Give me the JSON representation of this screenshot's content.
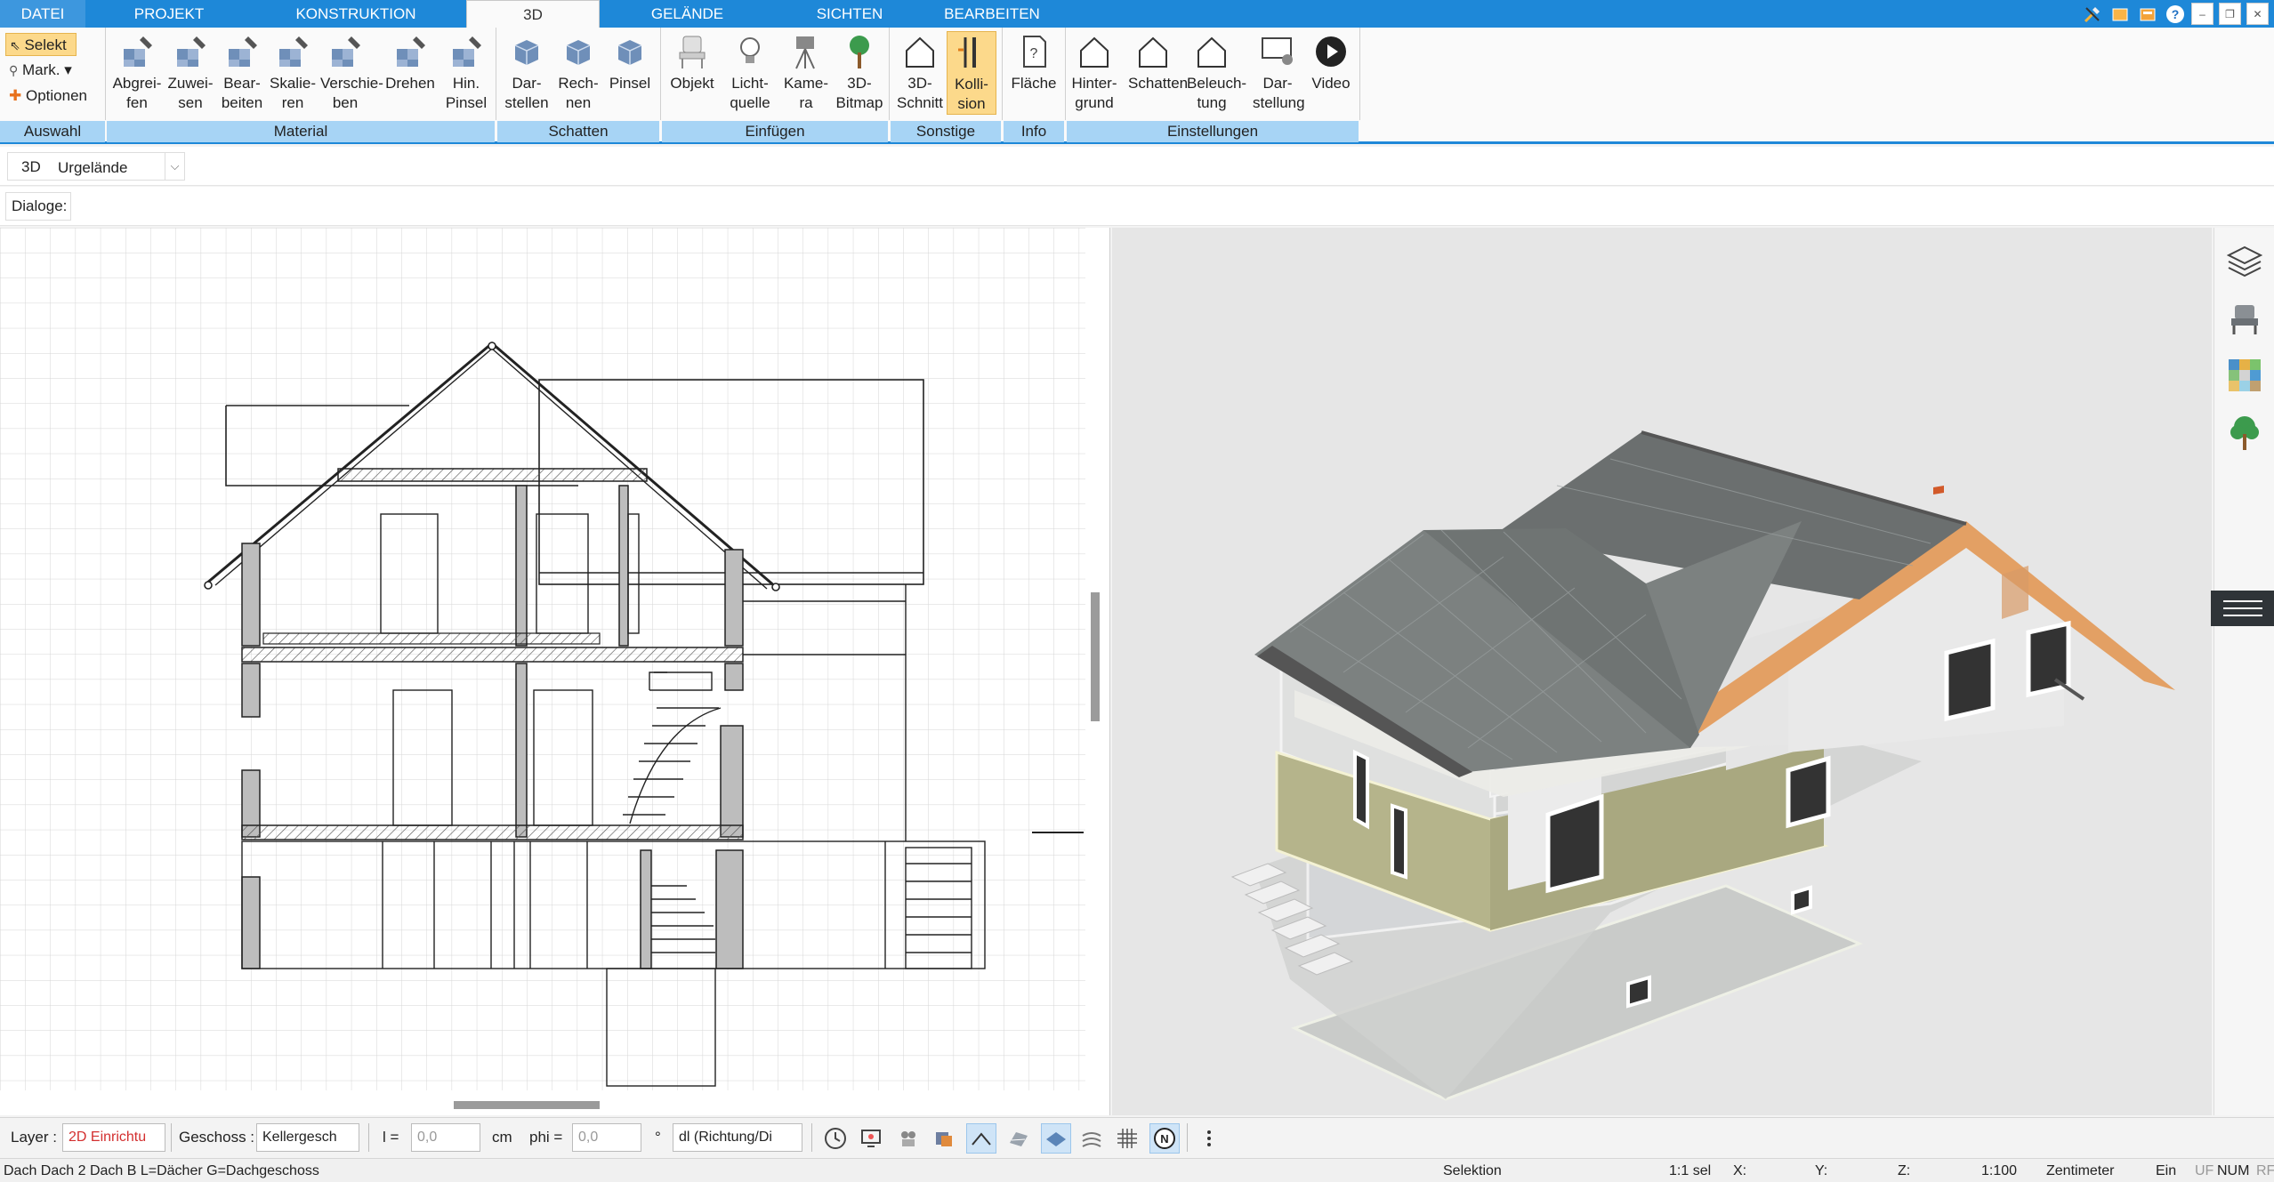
{
  "menu_tabs": [
    "DATEI",
    "PROJEKT",
    "KONSTRUKTION",
    "3D",
    "GELÄNDE",
    "SICHTEN",
    "BEARBEITEN"
  ],
  "window_controls": [
    "tools-icon",
    "window-icon",
    "window2-icon",
    "help-icon",
    "minimize-icon",
    "restore-icon",
    "close-icon"
  ],
  "selection": {
    "select_label": "Selekt",
    "mark_label": "Mark.",
    "options_label": "Optionen",
    "group": "Auswahl"
  },
  "ribbon": {
    "material": {
      "group": "Material",
      "buttons": [
        "Abgrei-\nfen",
        "Zuwei-\nsen",
        "Bear-\nbeiten",
        "Skalie-\nren",
        "Verschie-\nben",
        "Drehen",
        "Hin.\nPinsel"
      ]
    },
    "schatten": {
      "group": "Schatten",
      "buttons": [
        "Dar-\nstellen",
        "Rech-\nnen",
        "Pinsel"
      ]
    },
    "einfuegen": {
      "group": "Einfügen",
      "buttons": [
        "Objekt",
        "Licht-\nquelle",
        "Kame-\nra",
        "3D-\nBitmap"
      ]
    },
    "sonstige": {
      "group": "Sonstige",
      "buttons": [
        "3D-\nSchnitt",
        "Kolli-\nsion"
      ]
    },
    "info": {
      "group": "Info",
      "buttons": [
        "Fläche"
      ]
    },
    "einstellungen": {
      "group": "Einstellungen",
      "buttons": [
        "Hinter-\ngrund",
        "Schatten",
        "Beleuch-\ntung",
        "Dar-\nstellung",
        "Video"
      ]
    }
  },
  "optbar": {
    "mode_label": "3D",
    "terrain_value": "Urgelände"
  },
  "dialogbar": {
    "label": "Dialoge:"
  },
  "bottombar": {
    "layer_label": "Layer :",
    "layer_value": "2D Einrichtu",
    "floor_label": "Geschoss :",
    "floor_value": "Kellergesch",
    "l_label": "l =",
    "l_value": "0,0",
    "l_unit": "cm",
    "phi_label": "phi =",
    "phi_value": "0,0",
    "phi_unit": "°",
    "dl_value": "dl (Richtung/Di"
  },
  "statusbar": {
    "left": "Dach Dach 2 Dach B L=Dächer G=Dachgeschoss",
    "mode": "Selektion",
    "sel": "1:1 sel",
    "x": "X:",
    "y": "Y:",
    "z": "Z:",
    "scale": "1:100",
    "unit": "Zentimeter",
    "ein": "Ein",
    "uf": "UF",
    "num": "NUM",
    "rf": "RF"
  },
  "colors": {
    "accent": "#1e88d8",
    "group_bg": "#a7d4f5",
    "active_btn": "#fcd98b",
    "layer_red": "#d32f2f"
  }
}
